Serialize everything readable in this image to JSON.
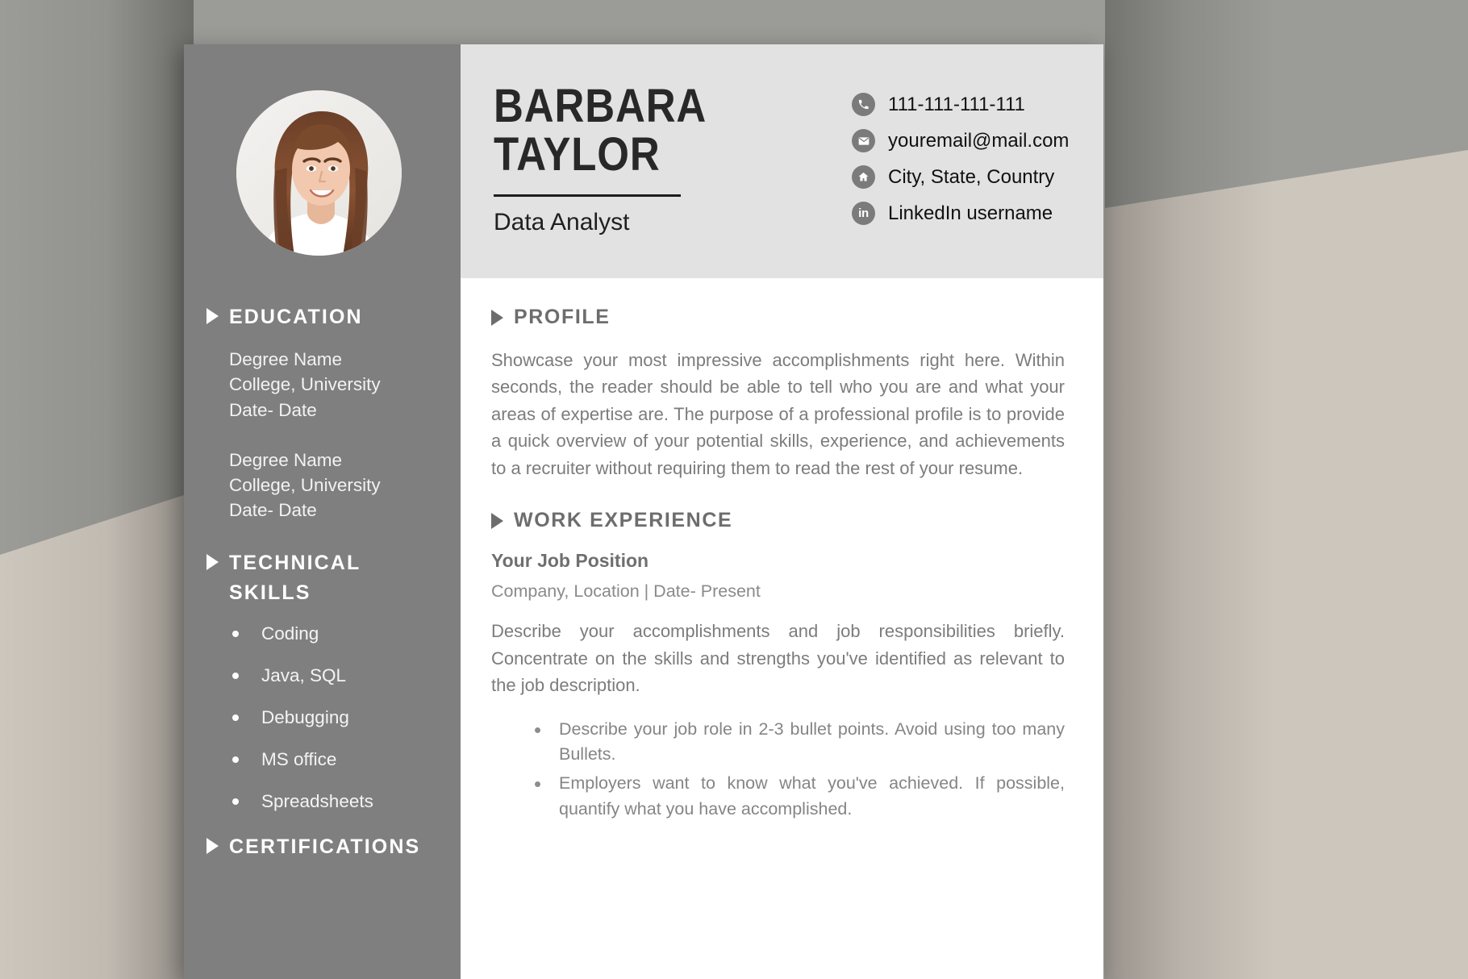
{
  "document": {
    "type": "resume-template"
  },
  "header": {
    "name_line1": "BARBARA",
    "name_line2": "TAYLOR",
    "job_title": "Data Analyst",
    "contacts": [
      {
        "icon": "phone-icon",
        "text": "111-111-111-111"
      },
      {
        "icon": "email-icon",
        "text": "youremail@mail.com"
      },
      {
        "icon": "home-icon",
        "text": "City, State, Country"
      },
      {
        "icon": "linkedin-icon",
        "text": "LinkedIn username"
      }
    ]
  },
  "sidebar": {
    "education": {
      "heading": "EDUCATION",
      "entries": [
        {
          "degree": "Degree Name",
          "school": "College, University",
          "dates": "Date- Date"
        },
        {
          "degree": "Degree Name",
          "school": "College, University",
          "dates": "Date- Date"
        }
      ]
    },
    "technical_skills": {
      "heading": "TECHNICAL SKILLS",
      "items": [
        "Coding",
        "Java, SQL",
        "Debugging",
        "MS office",
        "Spreadsheets"
      ]
    },
    "certifications": {
      "heading": "CERTIFICATIONS"
    }
  },
  "main": {
    "profile": {
      "heading": "PROFILE",
      "text": "Showcase your most impressive accomplishments right here. Within seconds, the reader should be able to tell who you are and what your areas of expertise are. The purpose of a professional profile is to provide a quick overview of your potential skills, experience, and achievements to a recruiter without requiring them to read the rest of your resume."
    },
    "work_experience": {
      "heading": "WORK EXPERIENCE",
      "position": "Your Job Position",
      "meta": "Company, Location | Date- Present",
      "description": "Describe your accomplishments and job responsibilities briefly. Concentrate on the skills and strengths you've identified as relevant to the job description.",
      "bullets": [
        "Describe your job role in 2-3 bullet points. Avoid using too many Bullets.",
        "Employers want to know what you've achieved. If possible, quantify what you have accomplished."
      ]
    }
  },
  "colors": {
    "sidebar": "#7f7f7f",
    "header_band": "#e2e2e2",
    "heading_gray": "#6d6d6d",
    "body_gray": "#7c7c7c",
    "background_gray": "#9b9b97",
    "background_beige": "#cdc6bd"
  }
}
